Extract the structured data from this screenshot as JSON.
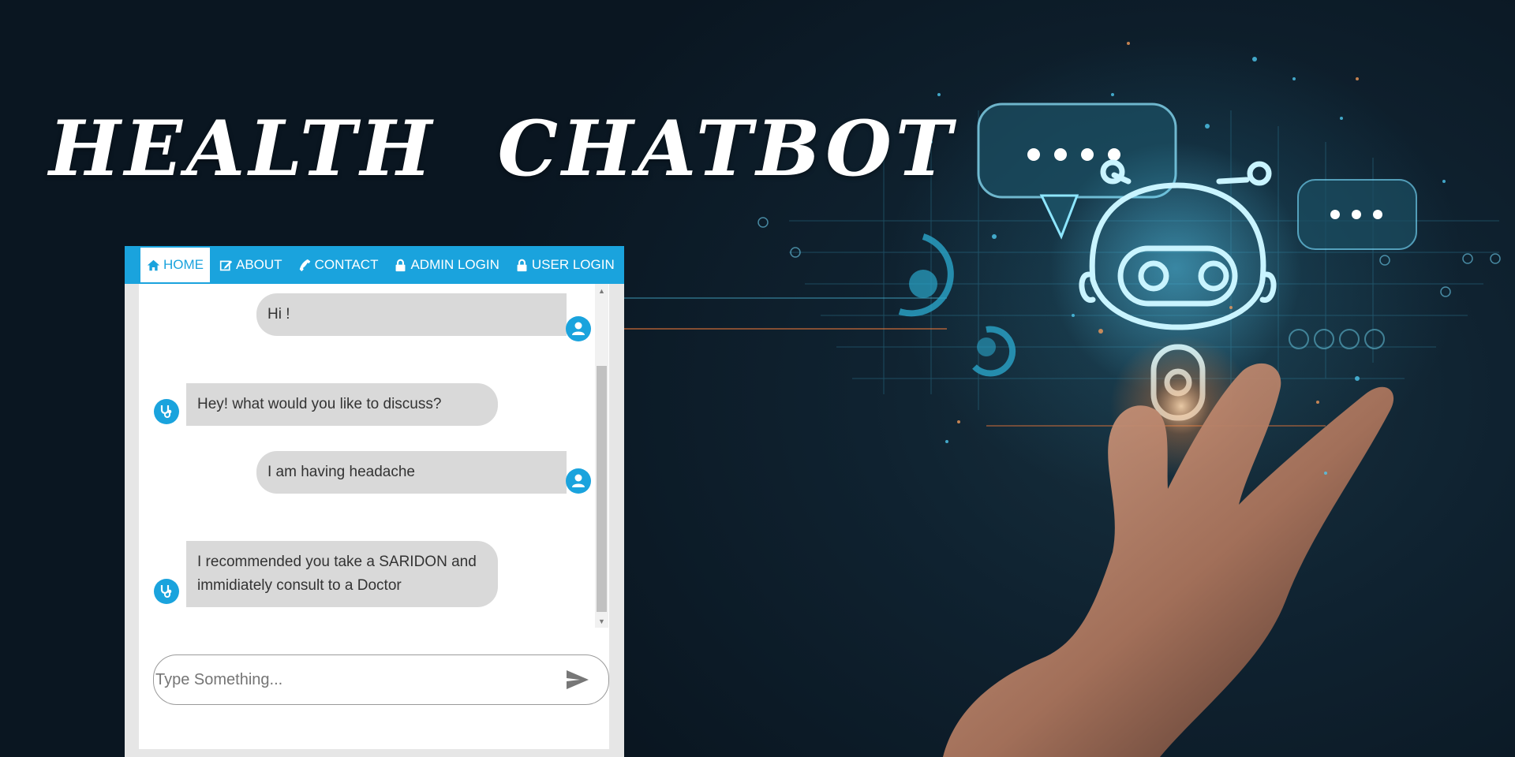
{
  "banner": {
    "title": "HEALTH CHATBOT"
  },
  "nav": {
    "items": [
      {
        "label": "HOME",
        "icon": "home-icon",
        "active": true
      },
      {
        "label": "ABOUT",
        "icon": "edit-icon",
        "active": false
      },
      {
        "label": "CONTACT",
        "icon": "phone-icon",
        "active": false
      },
      {
        "label": "ADMIN LOGIN",
        "icon": "lock-icon",
        "active": false
      },
      {
        "label": "USER LOGIN",
        "icon": "lock-icon",
        "active": false
      }
    ]
  },
  "chat": {
    "messages": [
      {
        "sender": "user",
        "text": "Hi !"
      },
      {
        "sender": "bot",
        "text": "Hey! what would you like to discuss?"
      },
      {
        "sender": "user",
        "text": "I am having headache"
      },
      {
        "sender": "bot",
        "line1": "I recommended you take a SARIDON and",
        "line2": "immidiately consult to a Doctor"
      }
    ],
    "input": {
      "placeholder": "Type Something...",
      "value": ""
    }
  },
  "colors": {
    "accent": "#1aa3dd",
    "bubble": "#d9d9d9",
    "background": "#0c1a25"
  }
}
